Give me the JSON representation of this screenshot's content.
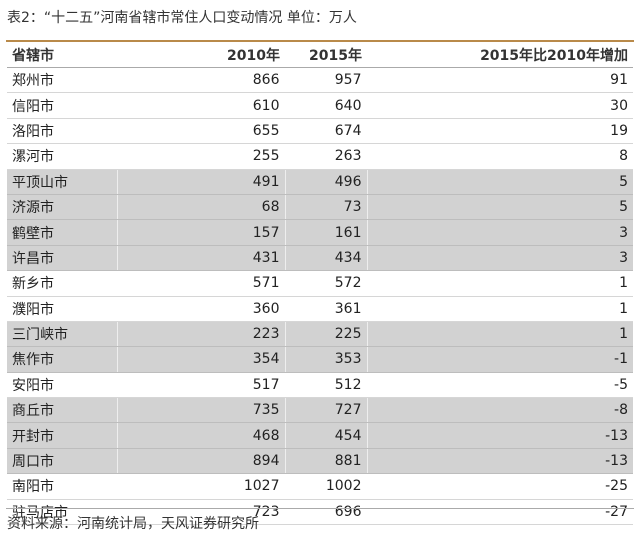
{
  "title": "表2：“十二五”河南省辖市常住人口变动情况  单位：万人",
  "table": {
    "headers": [
      "省辖市",
      "2010年",
      "2015年",
      "2015年比2010年增加"
    ],
    "rows": [
      {
        "city": "郑州市",
        "y2010": "866",
        "y2015": "957",
        "increase": "91",
        "shaded": false
      },
      {
        "city": "信阳市",
        "y2010": "610",
        "y2015": "640",
        "increase": "30",
        "shaded": false
      },
      {
        "city": "洛阳市",
        "y2010": "655",
        "y2015": "674",
        "increase": "19",
        "shaded": false
      },
      {
        "city": "漯河市",
        "y2010": "255",
        "y2015": "263",
        "increase": "8",
        "shaded": false
      },
      {
        "city": "平顶山市",
        "y2010": "491",
        "y2015": "496",
        "increase": "5",
        "shaded": true
      },
      {
        "city": "济源市",
        "y2010": "68",
        "y2015": "73",
        "increase": "5",
        "shaded": true
      },
      {
        "city": "鹤壁市",
        "y2010": "157",
        "y2015": "161",
        "increase": "3",
        "shaded": true
      },
      {
        "city": "许昌市",
        "y2010": "431",
        "y2015": "434",
        "increase": "3",
        "shaded": true
      },
      {
        "city": "新乡市",
        "y2010": "571",
        "y2015": "572",
        "increase": "1",
        "shaded": false
      },
      {
        "city": "濮阳市",
        "y2010": "360",
        "y2015": "361",
        "increase": "1",
        "shaded": false
      },
      {
        "city": "三门峡市",
        "y2010": "223",
        "y2015": "225",
        "increase": "1",
        "shaded": true
      },
      {
        "city": "焦作市",
        "y2010": "354",
        "y2015": "353",
        "increase": "-1",
        "shaded": true
      },
      {
        "city": "安阳市",
        "y2010": "517",
        "y2015": "512",
        "increase": "-5",
        "shaded": false
      },
      {
        "city": "商丘市",
        "y2010": "735",
        "y2015": "727",
        "increase": "-8",
        "shaded": true
      },
      {
        "city": "开封市",
        "y2010": "468",
        "y2015": "454",
        "increase": "-13",
        "shaded": true
      },
      {
        "city": "周口市",
        "y2010": "894",
        "y2015": "881",
        "increase": "-13",
        "shaded": true
      },
      {
        "city": "南阳市",
        "y2010": "1027",
        "y2015": "1002",
        "increase": "-25",
        "shaded": false
      },
      {
        "city": "驻马店市",
        "y2010": "723",
        "y2015": "696",
        "increase": "-27",
        "shaded": false
      }
    ]
  },
  "source": "资料来源：河南统计局，天风证券研究所",
  "colors": {
    "rule": "#b98a4a",
    "shade": "#d2d2d2",
    "divider": "#aaaaaa"
  }
}
